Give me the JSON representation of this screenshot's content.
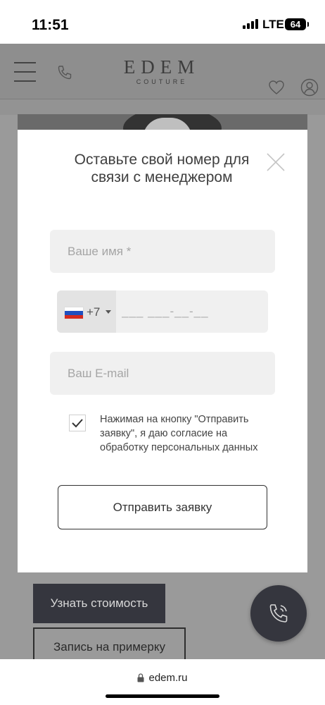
{
  "status_bar": {
    "time": "11:51",
    "network": "LTE",
    "battery": "64"
  },
  "header": {
    "logo_main": "EDEM",
    "logo_sub": "COUTURE"
  },
  "modal": {
    "title": "Оставьте свой номер для связи с менеджером",
    "name_placeholder": "Ваше имя *",
    "phone_code": "+7",
    "phone_placeholder": "___ ___-__-__",
    "email_placeholder": "Ваш E-mail",
    "consent_checked": true,
    "consent_text": "Нажимая на кнопку \"Отправить заявку\", я даю согласие на обработку персональных данных",
    "submit_label": "Отправить заявку"
  },
  "page": {
    "price_button": "Узнать стоимость",
    "fitting_button": "Запись на примерку"
  },
  "browser": {
    "url": "edem.ru"
  },
  "colors": {
    "overlay_gray": "#9a9a9a",
    "dark_button": "#35363e",
    "field_bg": "#f0f0f0"
  },
  "icons": [
    "menu-icon",
    "phone-icon",
    "heart-icon",
    "user-icon",
    "close-icon",
    "flag-ru-icon",
    "checkmark-icon",
    "phone-callback-icon",
    "lock-icon"
  ]
}
